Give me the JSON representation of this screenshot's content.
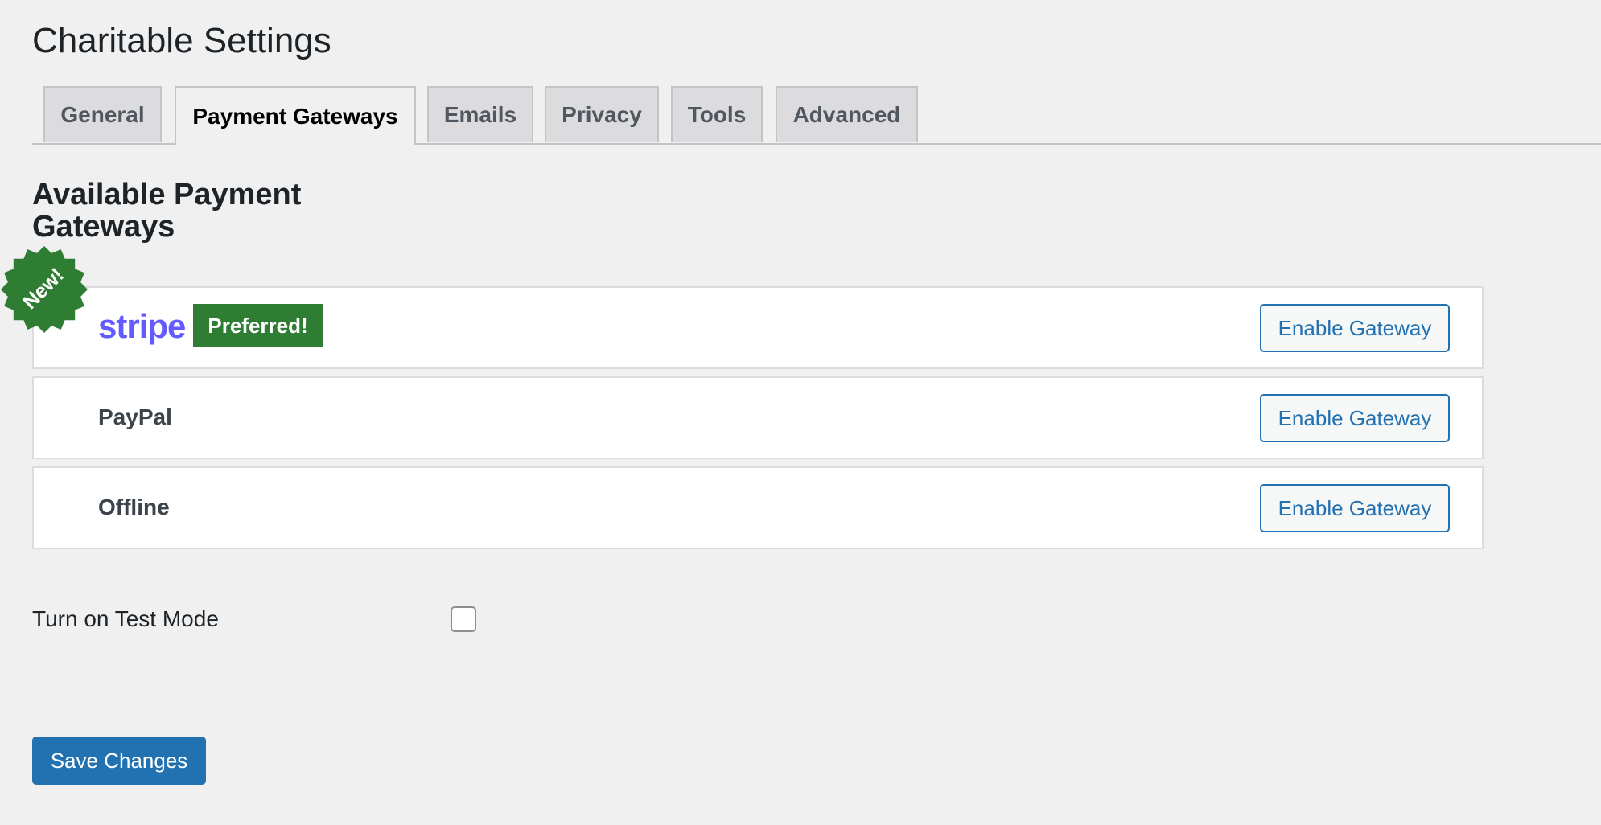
{
  "page": {
    "title": "Charitable Settings"
  },
  "tabs": [
    {
      "label": "General",
      "active": false
    },
    {
      "label": "Payment Gateways",
      "active": true
    },
    {
      "label": "Emails",
      "active": false
    },
    {
      "label": "Privacy",
      "active": false
    },
    {
      "label": "Tools",
      "active": false
    },
    {
      "label": "Advanced",
      "active": false
    }
  ],
  "section": {
    "heading": "Available Payment Gateways"
  },
  "gateways": [
    {
      "name": "stripe",
      "badge": "Preferred!",
      "new_seal": "New!",
      "button_label": "Enable Gateway"
    },
    {
      "name": "PayPal",
      "button_label": "Enable Gateway"
    },
    {
      "name": "Offline",
      "button_label": "Enable Gateway"
    }
  ],
  "test_mode": {
    "label": "Turn on Test Mode",
    "checked": false
  },
  "save": {
    "label": "Save Changes"
  },
  "colors": {
    "background": "#f0f0f1",
    "accent": "#2271b1",
    "badge_green": "#2e7d32",
    "stripe_brand": "#635bff"
  }
}
